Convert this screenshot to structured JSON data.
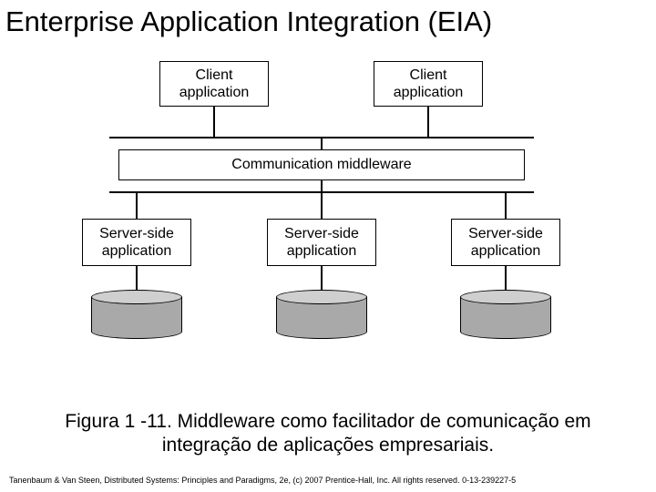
{
  "title": "Enterprise Application Integration (EIA)",
  "diagram": {
    "clients": [
      {
        "line1": "Client",
        "line2": "application"
      },
      {
        "line1": "Client",
        "line2": "application"
      }
    ],
    "middleware": "Communication middleware",
    "servers": [
      {
        "line1": "Server-side",
        "line2": "application"
      },
      {
        "line1": "Server-side",
        "line2": "application"
      },
      {
        "line1": "Server-side",
        "line2": "application"
      }
    ],
    "datastores": 3
  },
  "caption": {
    "line1": "Figura 1 -11. Middleware como facilitador de comunicação em",
    "line2": "integração de aplicações empresariais."
  },
  "credit": "Tanenbaum & Van Steen, Distributed Systems: Principles and Paradigms, 2e, (c) 2007 Prentice-Hall, Inc. All rights reserved. 0-13-239227-5"
}
